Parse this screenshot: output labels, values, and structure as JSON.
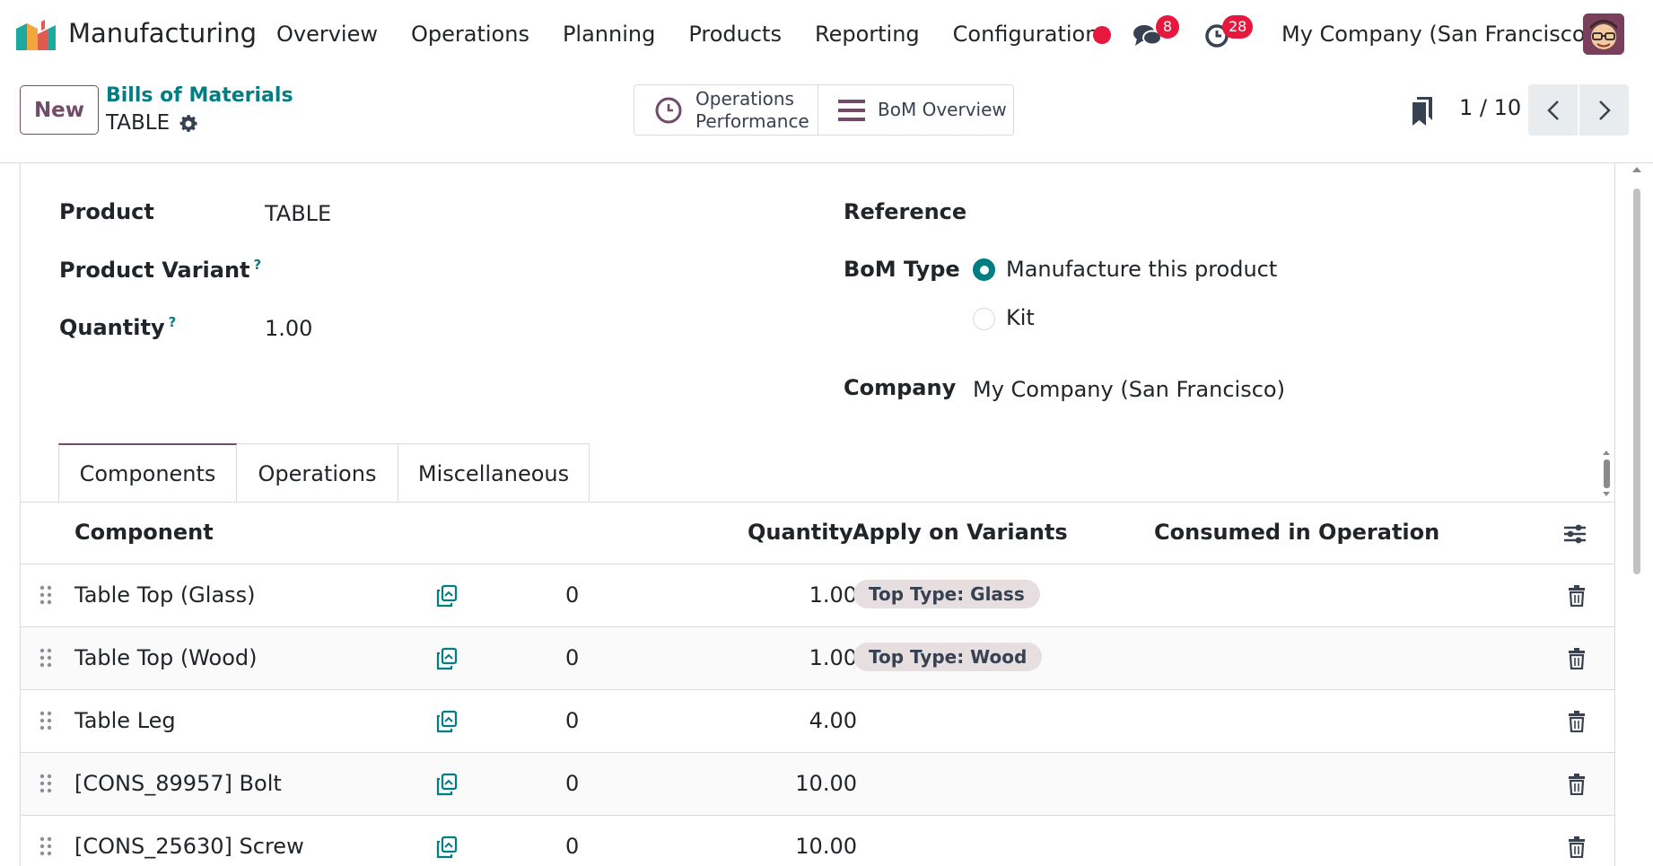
{
  "navbar": {
    "app_name": "Manufacturing",
    "menu": [
      "Overview",
      "Operations",
      "Planning",
      "Products",
      "Reporting",
      "Configuration"
    ],
    "messages_count": "8",
    "activities_count": "28",
    "company": "My Company (San Francisco)",
    "icons": {
      "logo": "manufacturing-app-icon",
      "messages": "chat-icon",
      "activities": "clock-icon",
      "recording": "record-dot",
      "avatar": "user-avatar"
    }
  },
  "control_panel": {
    "new_label": "New",
    "breadcrumb": "Bills of Materials",
    "record_name": "TABLE",
    "smart_buttons": [
      {
        "label": "Operations\nPerformance",
        "icon": "clock-icon"
      },
      {
        "label": "BoM Overview",
        "icon": "bars-icon"
      }
    ],
    "pager": "1 / 10"
  },
  "form": {
    "left": {
      "product_label": "Product",
      "product_value": "TABLE",
      "variant_label": "Product Variant",
      "quantity_label": "Quantity",
      "quantity_value": "1.00",
      "help_mark": "?"
    },
    "right": {
      "reference_label": "Reference",
      "bom_type_label": "BoM Type",
      "bom_type_options": [
        "Manufacture this product",
        "Kit"
      ],
      "bom_type_selected": "Manufacture this product",
      "company_label": "Company",
      "company_value": "My Company (San Francisco)"
    }
  },
  "tabs": [
    "Components",
    "Operations",
    "Miscellaneous"
  ],
  "active_tab": "Components",
  "components_table": {
    "headers": [
      "Component",
      "Quantity",
      "Apply on Variants",
      "Consumed in Operation"
    ],
    "rows": [
      {
        "component": "Table Top (Glass)",
        "count": "0",
        "quantity": "1.00",
        "variant": "Top Type: Glass"
      },
      {
        "component": "Table Top (Wood)",
        "count": "0",
        "quantity": "1.00",
        "variant": "Top Type: Wood"
      },
      {
        "component": "Table Leg",
        "count": "0",
        "quantity": "4.00",
        "variant": ""
      },
      {
        "component": "[CONS_89957] Bolt",
        "count": "0",
        "quantity": "10.00",
        "variant": ""
      },
      {
        "component": "[CONS_25630] Screw",
        "count": "0",
        "quantity": "10.00",
        "variant": ""
      }
    ]
  },
  "colors": {
    "brand": "#714b67",
    "accent": "#017e84",
    "badge": "#e7183d",
    "tag_bg": "#e7dedf"
  }
}
